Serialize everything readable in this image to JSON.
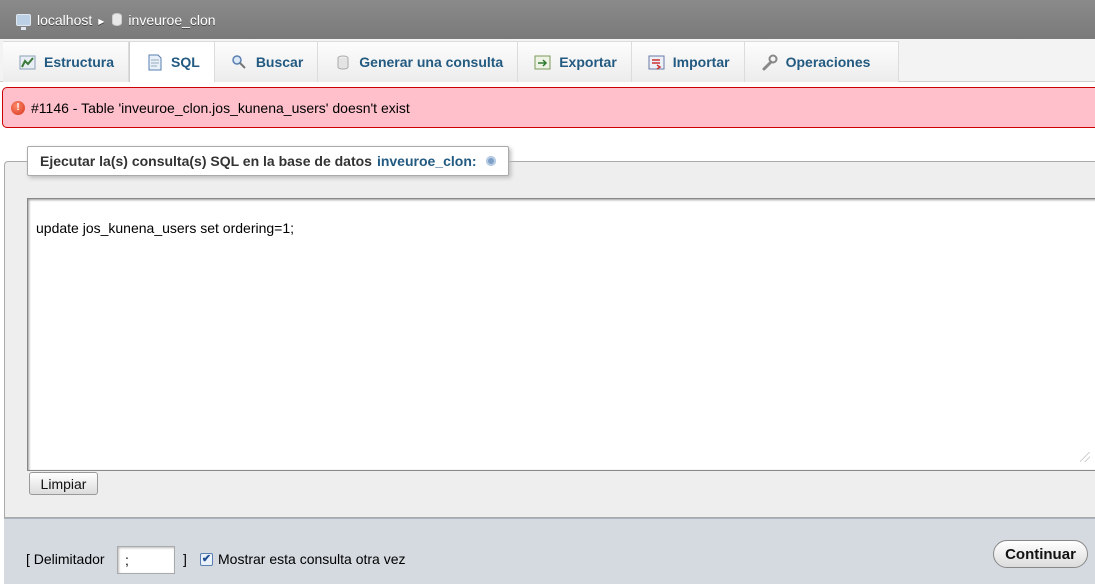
{
  "breadcrumb": {
    "server": "localhost",
    "database": "inveuroe_clon"
  },
  "tabs": [
    {
      "label": "Estructura",
      "icon": "structure-icon",
      "active": false
    },
    {
      "label": "SQL",
      "icon": "sql-icon",
      "active": true
    },
    {
      "label": "Buscar",
      "icon": "search-icon",
      "active": false
    },
    {
      "label": "Generar una consulta",
      "icon": "query-icon",
      "active": false
    },
    {
      "label": "Exportar",
      "icon": "export-icon",
      "active": false
    },
    {
      "label": "Importar",
      "icon": "import-icon",
      "active": false
    },
    {
      "label": "Operaciones",
      "icon": "wrench-icon",
      "active": false
    }
  ],
  "error": {
    "message": "#1146 - Table 'inveuroe_clon.jos_kunena_users' doesn't exist"
  },
  "sql_panel": {
    "legend_prefix": "Ejecutar la(s) consulta(s) SQL en la base de datos",
    "legend_db": "inveuroe_clon:",
    "query": "update jos_kunena_users set ordering=1;",
    "clear_label": "Limpiar"
  },
  "footer": {
    "delimiter_label": "[ Delimitador",
    "delimiter_value": ";",
    "delimiter_close": "]",
    "show_again_label": "Mostrar esta consulta otra vez",
    "show_again_checked": true,
    "submit_label": "Continuar"
  },
  "colors": {
    "link": "#235a81",
    "error_bg": "#ffc0cb",
    "error_border": "#cc0000",
    "topbar": "#808080",
    "footer_bg": "#d5dae1"
  }
}
